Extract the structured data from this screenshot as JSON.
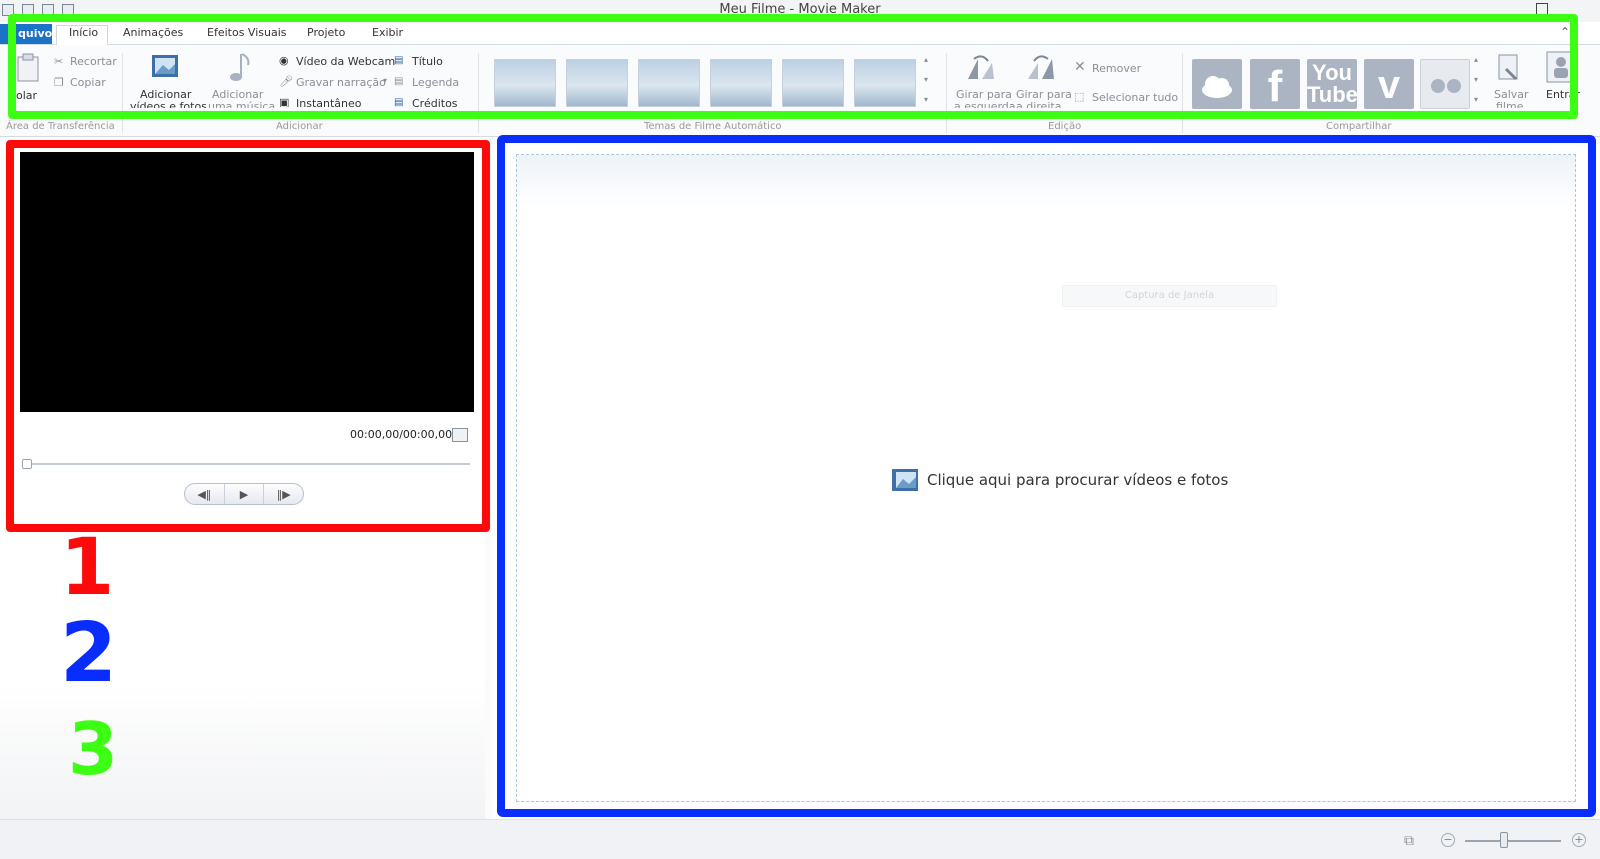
{
  "window": {
    "title": "Meu Filme - Movie Maker"
  },
  "tabs": {
    "file": "quivo",
    "items": [
      "Início",
      "Animações",
      "Efeitos Visuais",
      "Projeto",
      "Exibir"
    ]
  },
  "ribbon": {
    "clipboard": {
      "paste": "olar",
      "cut": "Recortar",
      "copy": "Copiar",
      "group": "Área de Transferência"
    },
    "add": {
      "add_videos": "Adicionar",
      "add_videos_2": "vídeos e fotos",
      "add_music": "Adicionar",
      "add_music_2": "uma música",
      "webcam": "Vídeo da Webcam",
      "narration": "Gravar narração",
      "snapshot": "Instantâneo",
      "title": "Título",
      "caption": "Legenda",
      "credits": "Créditos",
      "group": "Adicionar"
    },
    "themes": {
      "group": "Temas de Filme Automático"
    },
    "editing": {
      "rotate_left": "Girar para",
      "rotate_left_2": "a esquerda",
      "rotate_right": "Girar para",
      "rotate_right_2": "a direita",
      "remove": "Remover",
      "select_all": "Selecionar tudo",
      "group": "Edição"
    },
    "share": {
      "group": "Compartilhar",
      "youtube_1": "You",
      "youtube_2": "Tube",
      "save_movie": "Salvar",
      "save_movie_2": "filme",
      "sign_in": "Entrar"
    }
  },
  "preview": {
    "time": "00:00,00/00:00,00"
  },
  "storyboard": {
    "browse_text": "Clique aqui para procurar vídeos e fotos",
    "overlay_caption": "Captura de Janela"
  },
  "annotations": {
    "label_1": "1",
    "label_2": "2",
    "label_3": "3",
    "color_1": "#ff0a0a",
    "color_2": "#0a2dff",
    "color_3": "#3cff14"
  }
}
